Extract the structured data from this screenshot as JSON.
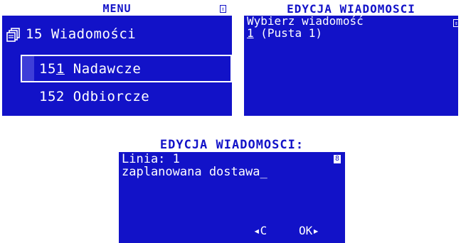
{
  "menu_screen": {
    "title": "MENU",
    "scroll_mark": "⇕",
    "folder": {
      "label": "15 Wiadomości",
      "icon": "folder-stack-icon"
    },
    "items": [
      {
        "prefix": "15",
        "underlined_char": "1",
        "suffix": " Nadawcze",
        "selected": true
      },
      {
        "label": "152 Odbiorcze",
        "selected": false
      }
    ]
  },
  "message_edit_screen": {
    "title": "EDYCJA WIADOMOSCI",
    "prompt": "Wybierz wiadomość",
    "scroll_mark": "⇕",
    "option_number": "1",
    "option_label": " (Pusta 1)"
  },
  "line_edit_screen": {
    "title": "EDYCJA WIADOMOSCI:",
    "line_label": "Linia: 1",
    "line_marker": "8",
    "text_value": "zaplanowana dostawa_",
    "back_label": "◂C",
    "ok_label": "OK▸"
  },
  "colors": {
    "screen_background": "#1212c8",
    "foreground": "#ffffff",
    "selection_stub": "#3e3ed8"
  }
}
